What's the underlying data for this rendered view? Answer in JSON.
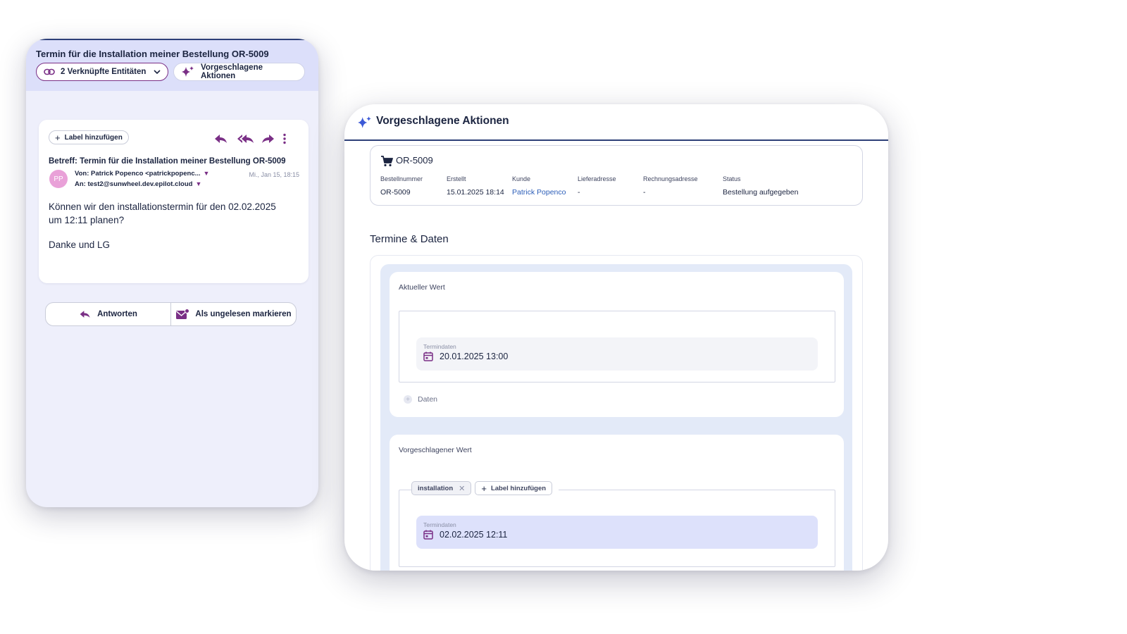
{
  "email_panel": {
    "title": "Termin für die Installation meiner Bestellung OR-5009",
    "linked_entities_label": "2 Verknüpfte Entitäten",
    "suggested_actions_label": "Vorgeschlagene Aktionen",
    "add_label": "Label hinzufügen",
    "subject": "Betreff: Termin für die Installation meiner Bestellung OR-5009",
    "avatar_initials": "PP",
    "from": "Von: Patrick Popenco <patrickpopenc...",
    "to": "An: test2@sunwheel.dev.epilot.cloud",
    "date": "Mi., Jan 15, 18:15",
    "body": "Können wir den installationstermin für den 02.02.2025 um 12:11 planen?",
    "greeting": "Danke und LG",
    "reply_label": "Antworten",
    "mark_unread_label": "Als ungelesen markieren"
  },
  "actions_panel": {
    "title": "Vorgeschlagene Aktionen",
    "order": {
      "id": "OR-5009",
      "fields": [
        {
          "label": "Bestellnummer",
          "value": "OR-5009"
        },
        {
          "label": "Erstellt",
          "value": "15.01.2025 18:14"
        },
        {
          "label": "Kunde",
          "value": "Patrick Popenco"
        },
        {
          "label": "Lieferadresse",
          "value": "-"
        },
        {
          "label": "Rechnungsadresse",
          "value": "-"
        },
        {
          "label": "Status",
          "value": "Bestellung aufgegeben"
        }
      ]
    },
    "section_title": "Termine & Daten",
    "current": {
      "label": "Aktueller Wert",
      "chip_label": "Termindaten",
      "date": "20.01.2025 13:00",
      "add_label": "Daten"
    },
    "suggested": {
      "label": "Vorgeschlagener Wert",
      "tag": "installation",
      "add_label": "Label hinzufügen",
      "chip_label": "Termindaten",
      "date": "02.02.2025 12:11"
    }
  },
  "colors": {
    "accent_purple": "#7a2f86",
    "spark_blue": "#3d5ad6",
    "header_lavender": "#dcdffa",
    "suggested_chip": "#dde1fb",
    "link_blue": "#2b5db8"
  }
}
